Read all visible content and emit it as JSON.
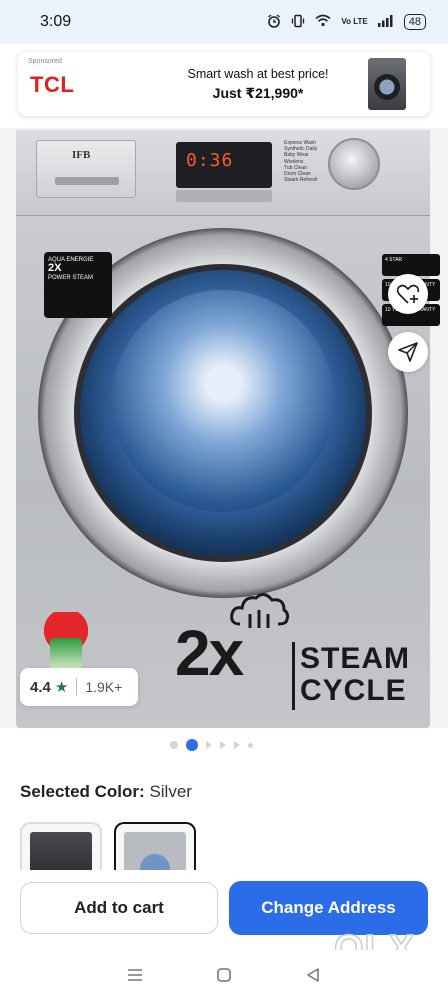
{
  "status_bar": {
    "time": "3:09",
    "network_label": "Vo LTE",
    "battery": "48"
  },
  "ad": {
    "sponsored": "Sponsored",
    "brand": "TCL",
    "line1": "Smart wash at best price!",
    "line2": "Just ₹21,990*"
  },
  "product_image": {
    "brand_on_drawer": "IFB",
    "display_digits": "0:36",
    "program_list": [
      "Express Wash",
      "Synthetic Daily",
      "Baby Wear",
      "Woolens",
      "Tub Clean",
      "Drum Clean",
      "Steam Refresh"
    ],
    "left_badge": {
      "line1": "AQUA ENERGIE",
      "line2": "2X",
      "line3": "POWER STEAM"
    },
    "right_badges": [
      "4 STAR",
      "10 YEAR WARRANTY",
      "10 YEAR WARRANTY"
    ],
    "steam_multiplier": "2x",
    "steam_word1": "STEAM",
    "steam_word2": "CYCLE"
  },
  "rating": {
    "value": "4.4",
    "count": "1.9K+"
  },
  "carousel": {
    "total": 6,
    "active_index": 1
  },
  "color_select": {
    "label": "Selected Color:",
    "value": "Silver",
    "options": [
      "Dark",
      "Silver"
    ],
    "selected": "Silver"
  },
  "cta": {
    "add_to_cart": "Add to cart",
    "change_address": "Change Address"
  },
  "watermark": "OLX",
  "colors": {
    "primary": "#2b6de8",
    "rating_star": "#1f7a3f",
    "ad_brand": "#e0211b",
    "status_bar_bg": "#eaf3fb"
  },
  "icons": {
    "wishlist": "heart-plus-icon",
    "share": "share-arrow-icon",
    "nav_menu": "menu-lines-icon",
    "nav_home": "square-home-icon",
    "nav_back": "triangle-back-icon"
  }
}
